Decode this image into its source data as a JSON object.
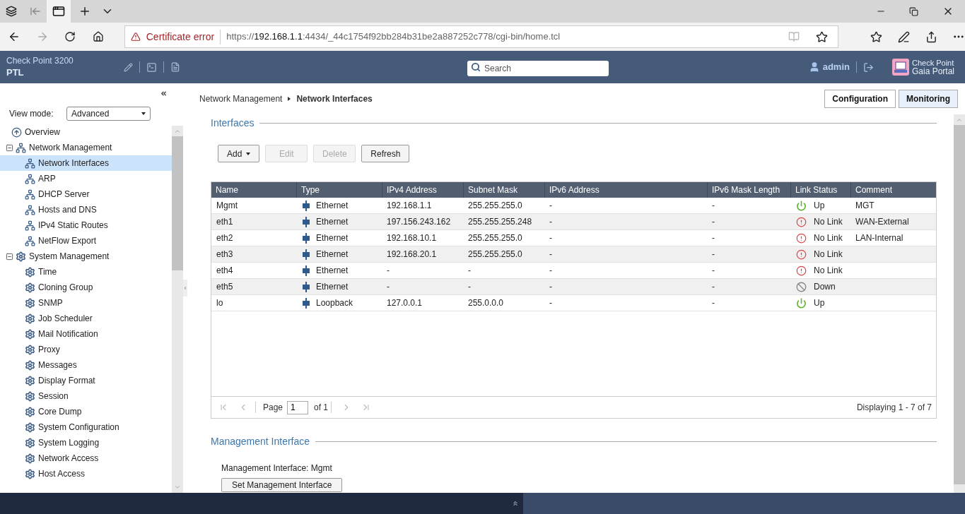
{
  "browser": {
    "warning": "Certificate error",
    "url_scheme": "https://",
    "url_host": "192.168.1.1",
    "url_path": ":4434/_44c1754f92bb284b31be2a887252c778/cgi-bin/home.tcl"
  },
  "header": {
    "product": "Check Point 3200",
    "hostname": "PTL",
    "search_placeholder": "Search",
    "user": "admin",
    "brand_top": "Check Point",
    "brand_bottom": "Gaia Portal"
  },
  "sidebar": {
    "view_mode_label": "View mode:",
    "view_mode": "Advanced",
    "tree": [
      {
        "label": "Overview",
        "kind": "overview",
        "selected": false
      },
      {
        "label": "Network Management",
        "kind": "network",
        "expanded": true,
        "selected": false,
        "children": [
          {
            "label": "Network Interfaces",
            "kind": "network",
            "selected": true
          },
          {
            "label": "ARP",
            "kind": "network",
            "selected": false
          },
          {
            "label": "DHCP Server",
            "kind": "network",
            "selected": false
          },
          {
            "label": "Hosts and DNS",
            "kind": "network",
            "selected": false
          },
          {
            "label": "IPv4 Static Routes",
            "kind": "network",
            "selected": false
          },
          {
            "label": "NetFlow Export",
            "kind": "network",
            "selected": false
          }
        ]
      },
      {
        "label": "System Management",
        "kind": "gear",
        "expanded": true,
        "selected": false,
        "children": [
          {
            "label": "Time",
            "kind": "gear",
            "selected": false
          },
          {
            "label": "Cloning Group",
            "kind": "gear",
            "selected": false
          },
          {
            "label": "SNMP",
            "kind": "gear",
            "selected": false
          },
          {
            "label": "Job Scheduler",
            "kind": "gear",
            "selected": false
          },
          {
            "label": "Mail Notification",
            "kind": "gear",
            "selected": false
          },
          {
            "label": "Proxy",
            "kind": "gear",
            "selected": false
          },
          {
            "label": "Messages",
            "kind": "gear",
            "selected": false
          },
          {
            "label": "Display Format",
            "kind": "gear",
            "selected": false
          },
          {
            "label": "Session",
            "kind": "gear",
            "selected": false
          },
          {
            "label": "Core Dump",
            "kind": "gear",
            "selected": false
          },
          {
            "label": "System Configuration",
            "kind": "gear",
            "selected": false
          },
          {
            "label": "System Logging",
            "kind": "gear",
            "selected": false
          },
          {
            "label": "Network Access",
            "kind": "gear",
            "selected": false
          },
          {
            "label": "Host Access",
            "kind": "gear",
            "selected": false
          }
        ]
      }
    ]
  },
  "breadcrumb": [
    "Network Management",
    "Network Interfaces"
  ],
  "mode_buttons": [
    {
      "label": "Configuration",
      "selected": false
    },
    {
      "label": "Monitoring",
      "selected": true
    }
  ],
  "interfaces": {
    "title": "Interfaces",
    "toolbar": [
      {
        "label": "Add",
        "kind": "dropdown",
        "disabled": false
      },
      {
        "label": "Edit",
        "kind": "plain",
        "disabled": true
      },
      {
        "label": "Delete",
        "kind": "plain",
        "disabled": true
      },
      {
        "label": "Refresh",
        "kind": "plain",
        "disabled": false
      }
    ],
    "table": {
      "columns": [
        "Name",
        "Type",
        "IPv4 Address",
        "Subnet Mask",
        "IPv6 Address",
        "IPv6 Mask Length",
        "Link Status",
        "Comment"
      ],
      "rows": [
        {
          "name": "Mgmt",
          "type": "Ethernet",
          "ipv4": "192.168.1.1",
          "mask": "255.255.255.0",
          "ipv6": "-",
          "ipv6_mask": "-",
          "status": {
            "label": "Up",
            "kind": "up"
          },
          "comment": "MGT"
        },
        {
          "name": "eth1",
          "type": "Ethernet",
          "ipv4": "197.156.243.162",
          "mask": "255.255.255.248",
          "ipv6": "-",
          "ipv6_mask": "-",
          "status": {
            "label": "No Link",
            "kind": "nolink"
          },
          "comment": "WAN-External"
        },
        {
          "name": "eth2",
          "type": "Ethernet",
          "ipv4": "192.168.10.1",
          "mask": "255.255.255.0",
          "ipv6": "-",
          "ipv6_mask": "-",
          "status": {
            "label": "No Link",
            "kind": "nolink"
          },
          "comment": "LAN-Internal"
        },
        {
          "name": "eth3",
          "type": "Ethernet",
          "ipv4": "192.168.20.1",
          "mask": "255.255.255.0",
          "ipv6": "-",
          "ipv6_mask": "-",
          "status": {
            "label": "No Link",
            "kind": "nolink"
          }
        },
        {
          "name": "eth4",
          "type": "Ethernet",
          "ipv4": "-",
          "mask": "-",
          "ipv6": "-",
          "ipv6_mask": "-",
          "status": {
            "label": "No Link",
            "kind": "nolink"
          }
        },
        {
          "name": "eth5",
          "type": "Ethernet",
          "ipv4": "-",
          "mask": "-",
          "ipv6": "-",
          "ipv6_mask": "-",
          "status": {
            "label": "Down",
            "kind": "down"
          }
        },
        {
          "name": "lo",
          "type": "Loopback",
          "ipv4": "127.0.0.1",
          "mask": "255.0.0.0",
          "ipv6": "-",
          "ipv6_mask": "-",
          "status": {
            "label": "Up",
            "kind": "up"
          }
        }
      ]
    },
    "pager": {
      "page_label": "Page",
      "page": "1",
      "of": "of 1",
      "summary": "Displaying 1 - 7 of 7"
    }
  },
  "management": {
    "title": "Management Interface",
    "text": "Management Interface: Mgmt",
    "button": "Set Management Interface"
  }
}
